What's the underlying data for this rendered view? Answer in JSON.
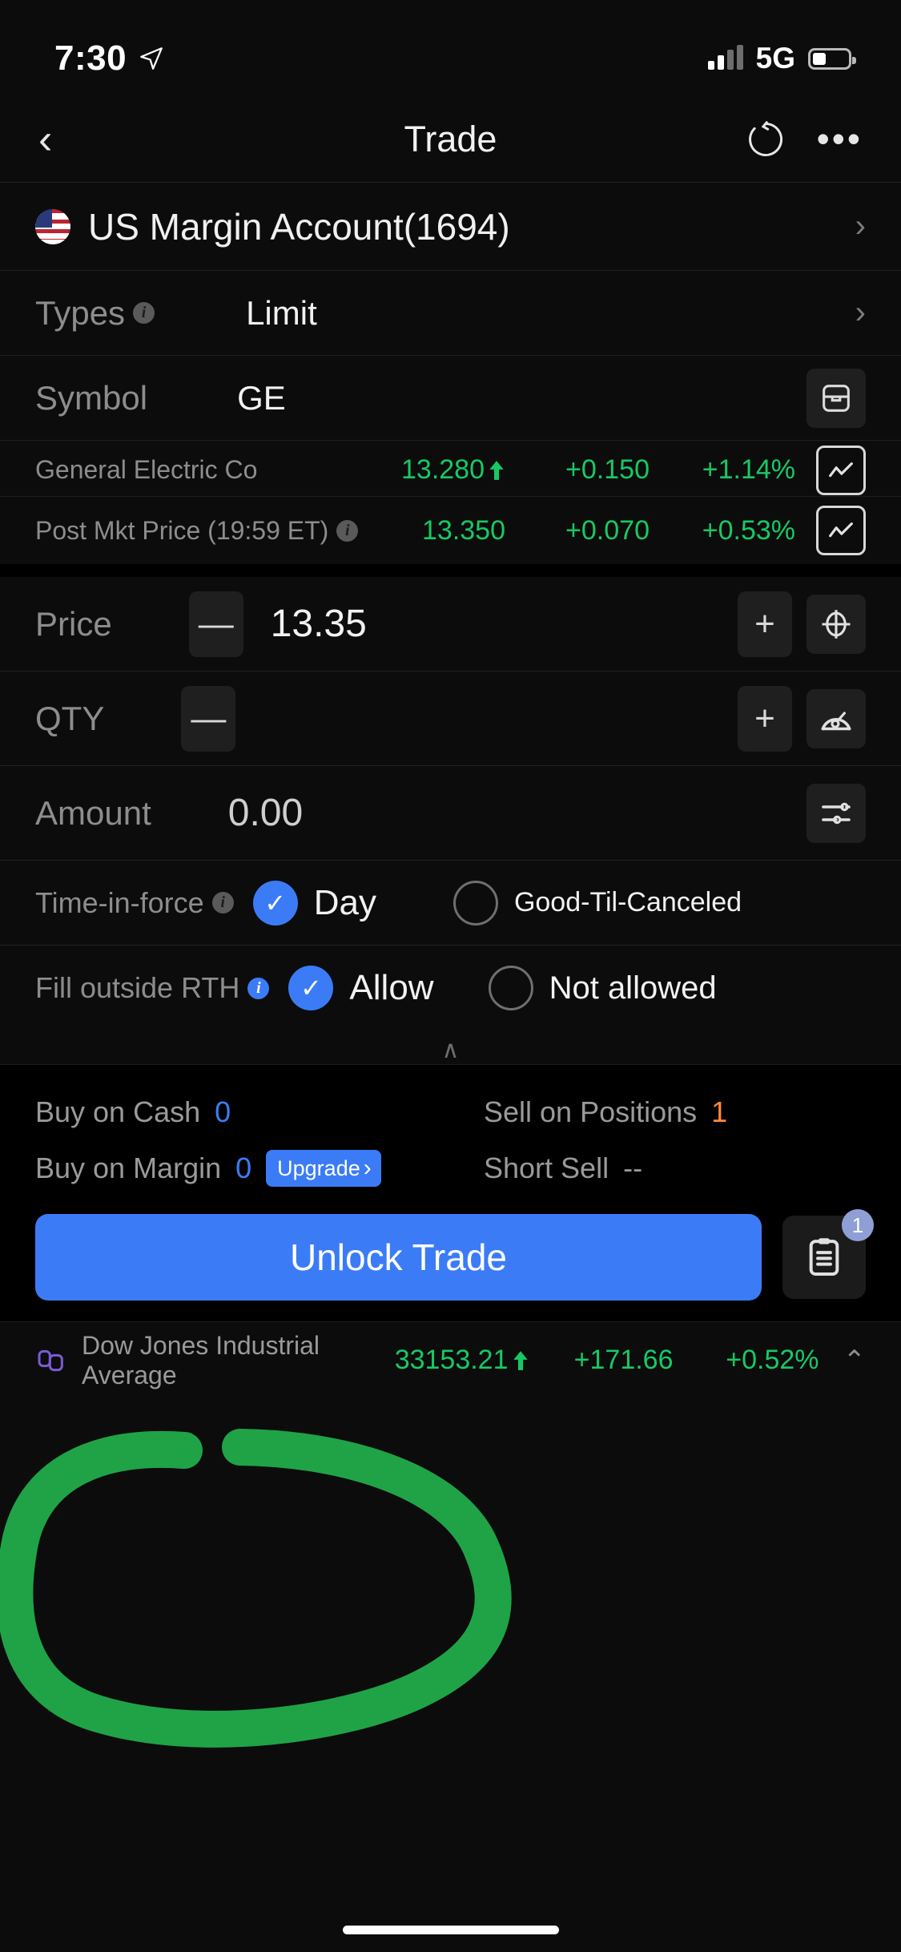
{
  "status_bar": {
    "time": "7:30",
    "location_icon": "location-arrow-icon",
    "network": "5G",
    "signal_icon": "signal-bars-icon",
    "battery_icon": "battery-icon"
  },
  "nav": {
    "back_icon": "chevron-left-icon",
    "title": "Trade",
    "refresh_icon": "refresh-icon",
    "more_label": "•••"
  },
  "account": {
    "flag_icon": "us-flag-icon",
    "name": "US Margin Account(1694)",
    "chevron": "›"
  },
  "order_form": {
    "types": {
      "label": "Types",
      "value": "Limit",
      "chevron": "›",
      "info_icon": "info-icon"
    },
    "symbol": {
      "label": "Symbol",
      "value": "GE",
      "action_icon": "wallet-icon"
    },
    "price": {
      "label": "Price",
      "value": "13.35",
      "minus": "—",
      "plus": "+",
      "tool_icon": "target-crosshair-icon"
    },
    "qty": {
      "label": "QTY",
      "value": "",
      "minus": "—",
      "plus": "+",
      "tool_icon": "gauge-icon"
    },
    "amount": {
      "label": "Amount",
      "value": "0.00",
      "tool_icon": "sliders-icon"
    },
    "time_in_force": {
      "label": "Time-in-force",
      "info_icon": "info-icon",
      "options": [
        {
          "label": "Day",
          "selected": true
        },
        {
          "label": "Good-Til-Canceled",
          "selected": false
        }
      ]
    },
    "fill_outside_rth": {
      "label": "Fill outside RTH",
      "info_icon": "info-icon-blue",
      "options": [
        {
          "label": "Allow",
          "selected": true
        },
        {
          "label": "Not allowed",
          "selected": false
        }
      ]
    },
    "collapse_handle": "∧"
  },
  "quotes": [
    {
      "name": "General Electric Co",
      "price": "13.280",
      "arrow": "↑",
      "change": "+0.150",
      "percent": "+1.14%",
      "chart_icon": "line-chart-icon",
      "info_icon": null
    },
    {
      "name": "Post Mkt Price (19:59 ET)",
      "price": "13.350",
      "arrow": "",
      "change": "+0.070",
      "percent": "+0.53%",
      "chart_icon": "line-chart-icon",
      "info_icon": "info-icon"
    }
  ],
  "buying_power": [
    {
      "label": "Buy on Cash",
      "value": "0",
      "value_color": "blue",
      "right_label": "Sell on Positions",
      "right_value": "1",
      "right_color": "orange",
      "upgrade": null
    },
    {
      "label": "Buy on Margin",
      "value": "0",
      "value_color": "blue",
      "right_label": "Short Sell",
      "right_value": "--",
      "right_color": "grey",
      "upgrade": {
        "label": "Upgrade",
        "chevron": "›"
      }
    }
  ],
  "actions": {
    "unlock_label": "Unlock Trade",
    "orders_icon": "clipboard-icon",
    "orders_badge": "1"
  },
  "index_ticker": {
    "icon": "index-link-icon",
    "name": "Dow Jones Industrial Average",
    "value": "33153.21",
    "arrow": "↑",
    "change": "+171.66",
    "percent": "+0.52%",
    "expand_icon": "chevron-up-icon"
  },
  "colors": {
    "accent_blue": "#3b7cf6",
    "up_green": "#17c964",
    "warn_orange": "#ff8a3d",
    "annotation_green": "#22b14c",
    "background": "#0c0c0c"
  }
}
